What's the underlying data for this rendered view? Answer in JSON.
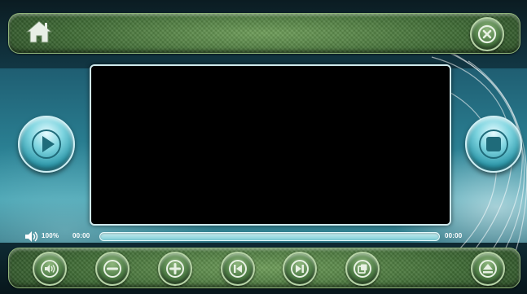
{
  "topbar": {
    "home_icon": "home-icon",
    "close_icon": "close-icon"
  },
  "side": {
    "play_icon": "play-icon",
    "stop_icon": "stop-icon"
  },
  "playback": {
    "volume": "100%",
    "time_start": "00:00",
    "time_end": "00:00",
    "progress": 0
  },
  "controls": [
    {
      "name": "mute-button",
      "icon": "mute-icon"
    },
    {
      "name": "volume-down-button",
      "icon": "minus-icon"
    },
    {
      "name": "volume-up-button",
      "icon": "plus-icon"
    },
    {
      "name": "previous-button",
      "icon": "skip-back-icon"
    },
    {
      "name": "next-button",
      "icon": "skip-forward-icon"
    },
    {
      "name": "fullscreen-button",
      "icon": "window-icon"
    },
    {
      "name": "eject-button",
      "icon": "eject-icon"
    }
  ],
  "colors": {
    "bar": "#4c7a44",
    "accent": "#2e98aa",
    "video": "#000000"
  }
}
